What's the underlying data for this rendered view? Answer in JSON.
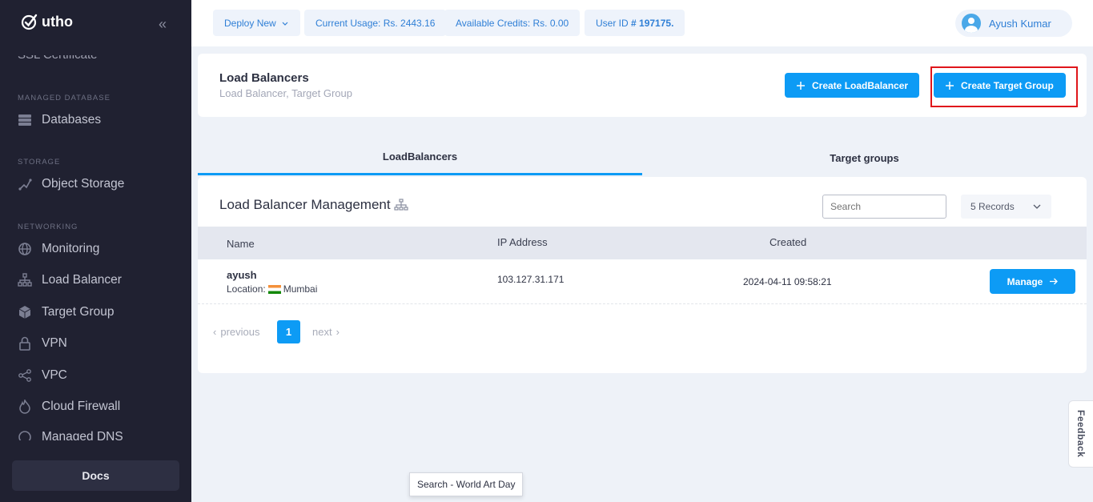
{
  "brand": {
    "name": "utho"
  },
  "sidebar": {
    "clipped_item": "SSL Certificate",
    "sections": [
      {
        "label": "MANAGED DATABASE"
      },
      {
        "label": "STORAGE"
      },
      {
        "label": "NETWORKING"
      }
    ],
    "items": [
      {
        "label": "Databases",
        "icon": "database-icon"
      },
      {
        "label": "Object Storage",
        "icon": "object-storage-icon"
      },
      {
        "label": "Monitoring",
        "icon": "globe-icon"
      },
      {
        "label": "Load Balancer",
        "icon": "network-tree-icon"
      },
      {
        "label": "Target Group",
        "icon": "cube-icon"
      },
      {
        "label": "VPN",
        "icon": "lock-icon"
      },
      {
        "label": "VPC",
        "icon": "share-nodes-icon"
      },
      {
        "label": "Cloud Firewall",
        "icon": "flame-icon"
      },
      {
        "label": "Managed DNS",
        "icon": "dns-icon"
      }
    ],
    "docs_label": "Docs"
  },
  "topbar": {
    "deploy_label": "Deploy New",
    "usage_label": "Current Usage: Rs. 2443.16",
    "credits_label": "Available Credits: Rs. 0.00",
    "userid_prefix": "User ID ",
    "userid_value": "# 197175.",
    "user_name": "Ayush Kumar"
  },
  "header": {
    "title": "Load Balancers",
    "subtitle": "Load Balancer, Target Group",
    "create_lb_label": "Create LoadBalancer",
    "create_tg_label": "Create Target Group"
  },
  "tabs": [
    {
      "label": "LoadBalancers",
      "active": true
    },
    {
      "label": "Target groups",
      "active": false
    }
  ],
  "table": {
    "title": "Load Balancer Management",
    "search_placeholder": "Search",
    "records_label": "5 Records",
    "columns": [
      "Name",
      "IP Address",
      "Created"
    ],
    "rows": [
      {
        "name": "ayush",
        "location_label": "Location:",
        "location": "Mumbai",
        "ip": "103.127.31.171",
        "created": "2024-04-11 09:58:21",
        "action": "Manage"
      }
    ]
  },
  "pagination": {
    "prev": "previous",
    "current": "1",
    "next": "next"
  },
  "tooltip": "Search - World Art Day",
  "feedback_label": "Feedback",
  "colors": {
    "accent": "#0d9bf5",
    "sidebar_bg": "#202131",
    "highlight": "#e0161b"
  }
}
